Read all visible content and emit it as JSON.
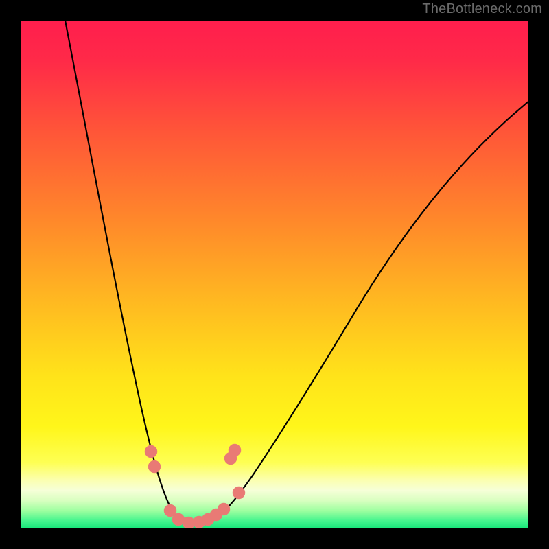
{
  "watermark": "TheBottleneck.com",
  "chart_data": {
    "type": "line",
    "title": "",
    "xlabel": "",
    "ylabel": "",
    "x_range_pct": [
      0,
      100
    ],
    "y_range_pct": [
      0,
      100
    ],
    "background_gradient": {
      "direction": "vertical",
      "stops": [
        {
          "pos": 0.0,
          "color": "#ff1e4d"
        },
        {
          "pos": 0.22,
          "color": "#ff5638"
        },
        {
          "pos": 0.55,
          "color": "#ffb821"
        },
        {
          "pos": 0.8,
          "color": "#fff61a"
        },
        {
          "pos": 0.92,
          "color": "#f6ffd8"
        },
        {
          "pos": 1.0,
          "color": "#17e67a"
        }
      ]
    },
    "series": [
      {
        "name": "bottleneck-curve",
        "style": "curve",
        "color": "#000000",
        "points_pct": [
          {
            "x": 8.8,
            "y": 100.0
          },
          {
            "x": 16.0,
            "y": 55.0
          },
          {
            "x": 23.6,
            "y": 24.3
          },
          {
            "x": 30.4,
            "y": 2.7
          },
          {
            "x": 33.8,
            "y": 0.9
          },
          {
            "x": 38.6,
            "y": 2.2
          },
          {
            "x": 45.9,
            "y": 10.8
          },
          {
            "x": 58.0,
            "y": 32.0
          },
          {
            "x": 74.0,
            "y": 58.0
          },
          {
            "x": 100.0,
            "y": 84.0
          }
        ]
      },
      {
        "name": "data-markers",
        "style": "scatter",
        "color": "#e97a75",
        "points_pct": [
          {
            "x": 25.7,
            "y": 15.1
          },
          {
            "x": 26.4,
            "y": 12.2
          },
          {
            "x": 29.5,
            "y": 3.5
          },
          {
            "x": 31.1,
            "y": 1.8
          },
          {
            "x": 33.1,
            "y": 1.1
          },
          {
            "x": 35.1,
            "y": 1.2
          },
          {
            "x": 36.9,
            "y": 1.8
          },
          {
            "x": 38.5,
            "y": 2.7
          },
          {
            "x": 40.0,
            "y": 3.8
          },
          {
            "x": 43.0,
            "y": 7.0
          },
          {
            "x": 41.4,
            "y": 13.8
          },
          {
            "x": 42.2,
            "y": 15.4
          }
        ]
      }
    ],
    "annotations": [
      {
        "text": "TheBottleneck.com",
        "role": "watermark",
        "position": "top-right"
      }
    ]
  }
}
